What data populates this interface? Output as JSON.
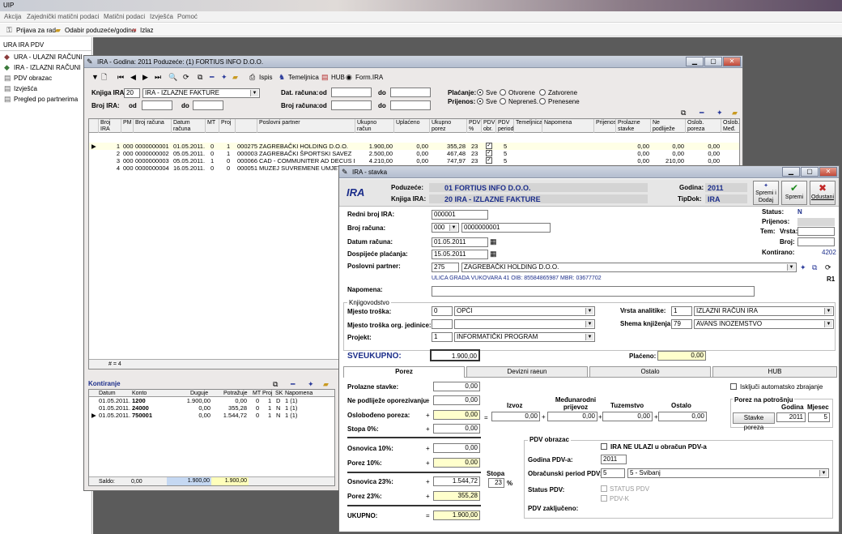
{
  "app": {
    "title": "UIP"
  },
  "menu": [
    "Akcija",
    "Zajednički matični podaci",
    "Matični podaci",
    "Izvješća",
    "Pomoć"
  ],
  "toolbar": {
    "prijava": "Prijava za rad",
    "odabir": "Odabir poduzeće/godina",
    "izlaz": "Izlaz"
  },
  "sidebar": {
    "header": "URA IRA PDV",
    "items": [
      "URA - ULAZNI RAČUNI",
      "IRA - IZLAZNI RAČUNI",
      "PDV obrazac",
      "Izvješća",
      "Pregled po partnerima"
    ]
  },
  "ira_window": {
    "title": "IRA - Godina: 2011   Poduzeće: (1) FORTIUS INFO D.O.O.",
    "toolbar": {
      "ispis": "Ispis",
      "temeljnica": "Temeljnica",
      "hub": "HUB",
      "form": "Form.IRA"
    },
    "filter": {
      "knjiga_label": "Knjiga IRA:",
      "knjiga_num": "20",
      "knjiga_name": "IRA - IZLAZNE FAKTURE",
      "broj_label": "Broj IRA:",
      "od": "od",
      "do": "do",
      "dat_label": "Dat. računa:",
      "brojr_label": "Broj računa:",
      "placanje_label": "Plaćanje:",
      "prijenos_label": "Prijenos:",
      "pl_opts": [
        "Sve",
        "Otvorene",
        "Zatvorene"
      ],
      "pr_opts": [
        "Sve",
        "Nepreneš.",
        "Prenesene"
      ]
    },
    "columns": [
      "Broj IRA",
      "PM",
      "Broj računa",
      "Datum računa",
      "MT",
      "Proj",
      "",
      "Poslovni partner",
      "Ukupno račun",
      "Uplaćeno",
      "Ukupno porez",
      "PDV %",
      "PDV obr.",
      "PDV period",
      "Temeljnica",
      "Napomena",
      "Prijenos",
      "Prolazne stavke",
      "Ne podliježe oporezivanju",
      "Oslob. poreza Izvoz",
      "Oslob. Međ."
    ],
    "rows": [
      [
        "1",
        "000",
        "0000000001",
        "01.05.2011.",
        "0",
        "1",
        "000275",
        "ZAGREBAČKI HOLDING D.O.O.",
        "1.900,00",
        "0,00",
        "355,28",
        "23",
        "",
        "5",
        "",
        "",
        "",
        "0,00",
        "0,00",
        "0,00"
      ],
      [
        "2",
        "000",
        "0000000002",
        "05.05.2011.",
        "0",
        "1",
        "000003",
        "ZAGREBAČKI ŠPORTSKI SAVEZ",
        "2.500,00",
        "0,00",
        "467,48",
        "23",
        "",
        "5",
        "",
        "",
        "",
        "0,00",
        "0,00",
        "0,00"
      ],
      [
        "3",
        "000",
        "0000000003",
        "05.05.2011.",
        "1",
        "0",
        "000066",
        "CAD - COMMUNITER AD DECUS D.O.",
        "4.210,00",
        "0,00",
        "747,97",
        "23",
        "",
        "5",
        "",
        "",
        "",
        "0,00",
        "210,00",
        "0,00"
      ],
      [
        "4",
        "000",
        "0000000004",
        "16.05.2011.",
        "0",
        "0",
        "000051",
        "MUZEJ SUVREMENE UMJETNOSTI",
        "",
        "",
        "",
        "",
        "",
        "",
        "",
        "",
        "",
        "",
        "",
        ""
      ]
    ],
    "count": "# = 4",
    "kontiranje": {
      "title": "Kontiranje",
      "columns": [
        "Datum",
        "Konto",
        "Duguje",
        "Potražuje",
        "MT",
        "Proj",
        "SK",
        "Napomena"
      ],
      "rows": [
        [
          "01.05.2011.",
          "1200",
          "1.900,00",
          "0,00",
          "0",
          "1",
          "D",
          "1 (1)"
        ],
        [
          "01.05.2011.",
          "24000",
          "0,00",
          "355,28",
          "0",
          "1",
          "N",
          "1 (1)"
        ],
        [
          "01.05.2011.",
          "750001",
          "0,00",
          "1.544,72",
          "0",
          "1",
          "N",
          "1 (1)"
        ]
      ],
      "saldo_label": "Saldo:",
      "saldo": "0,00",
      "duguje_total": "1.900,00",
      "potrazuje_total": "1.900,00"
    }
  },
  "stavka": {
    "title": "IRA - stavka",
    "logo": "IRA",
    "poduzece_label": "Poduzeće:",
    "poduzece": "01 FORTIUS INFO D.O.O.",
    "knjiga_label": "Knjiga IRA:",
    "knjiga": "20 IRA - IZLAZNE FAKTURE",
    "godina_label": "Godina:",
    "godina": "2011",
    "tipdok_label": "TipDok:",
    "tipdok": "IRA",
    "btn_spremi_dodaj": "Spremi i Dodaj",
    "btn_spremi": "Spremi",
    "btn_odustani": "Odustani",
    "redni_label": "Redni broj IRA:",
    "redni": "000001",
    "broj_label": "Broj računa:",
    "broj_pm": "000",
    "broj": "0000000001",
    "datum_label": "Datum računa:",
    "datum": "01.05.2011",
    "dosp_label": "Dospijeće plaćanja:",
    "dosp": "15.05.2011",
    "partner_label": "Poslovni partner:",
    "partner_num": "275",
    "partner": "ZAGREBAČKI HOLDING D.O.O.",
    "partner_addr": "ULICA GRADA VUKOVARA 41  OIB: 85584865987   MBR: 03677702",
    "r1": "R1",
    "status_label": "Status:",
    "status": "N",
    "prijenos_label": "Prijenos:",
    "tem_label": "Tem:",
    "vrsta_label": "Vrsta:",
    "broj2_label": "Broj:",
    "kontirano_label": "Kontirano:",
    "kontirano": "4202",
    "napomena_label": "Napomena:",
    "knjigovodstvo": "Knjigovodstvo",
    "mt_label": "Mjesto troška:",
    "mt_num": "0",
    "mt": "OPĆI",
    "mtoj_label": "Mjesto troška org. jedinice:",
    "projekt_label": "Projekt:",
    "projekt_num": "1",
    "projekt": "INFORMATIČKI PROGRAM",
    "vrsta_an_label": "Vrsta analitike:",
    "vrsta_an_num": "1",
    "vrsta_an": "IZLAZNI RAČUN IRA",
    "shema_label": "Shema knjiženja:",
    "shema_num": "79",
    "shema": "AVANS INOZEMSTVO",
    "sveukupno_label": "SVEUKUPNO:",
    "sveukupno": "1.900,00",
    "placeno_label": "Plaćeno:",
    "placeno": "0,00",
    "tabs": [
      "Porez",
      "Devizni raeun",
      "Ostalo",
      "HUB"
    ],
    "porez": {
      "prolazne_label": "Prolazne stavke:",
      "prolazne": "0,00",
      "nepod_label": "Ne podliježe oporezivanju:",
      "nepod": "0,00",
      "oslob_label": "Oslobođeno poreza:",
      "oslob": "0,00",
      "stopa0_label": "Stopa 0%:",
      "stopa0": "0,00",
      "osn10_label": "Osnovica 10%:",
      "osn10": "0,00",
      "por10_label": "Porez 10%:",
      "por10": "0,00",
      "osn23_label": "Osnovica 23%:",
      "osn23": "1.544,72",
      "por23_label": "Porez 23%:",
      "por23": "355,28",
      "ukupno_label": "UKUPNO:",
      "ukupno": "1.900,00",
      "stopa_label": "Stopa",
      "stopa": "23",
      "pct": "%",
      "izvoz_label": "Izvoz",
      "izvoz": "0,00",
      "medj_label": "Međunarodni prijevoz",
      "medj": "0,00",
      "tuz_label": "Tuzemstvo",
      "tuz": "0,00",
      "ostalo_label": "Ostalo",
      "ostalo": "0,00",
      "iskljuci": "Isključi automatsko zbrajanje",
      "potrosnja_title": "Porez na potrošnju",
      "godina_col": "Godina",
      "mjesec_col": "Mjesec",
      "stavke_btn": "Stavke poreza",
      "pp_godina": "2011",
      "pp_mjesec": "5",
      "pdv_title": "PDV obrazac",
      "ne_ulazi": "IRA NE ULAZI u obračun PDV-a",
      "godina_pdv_label": "Godina PDV-a:",
      "godina_pdv": "2011",
      "period_label": "Obračunski period PDV:",
      "period_num": "5",
      "period": "5 - Svibanj",
      "status_pdv_label": "Status PDV:",
      "status_pdv": "STATUS PDV",
      "pdvk": "PDV-K",
      "zakljuceno_label": "PDV zaključeno:"
    }
  },
  "colors": {
    "accent_blue": "#1b2d8a",
    "field_yellow": "#ffffcc",
    "header_gray": "#d6d6d6"
  }
}
